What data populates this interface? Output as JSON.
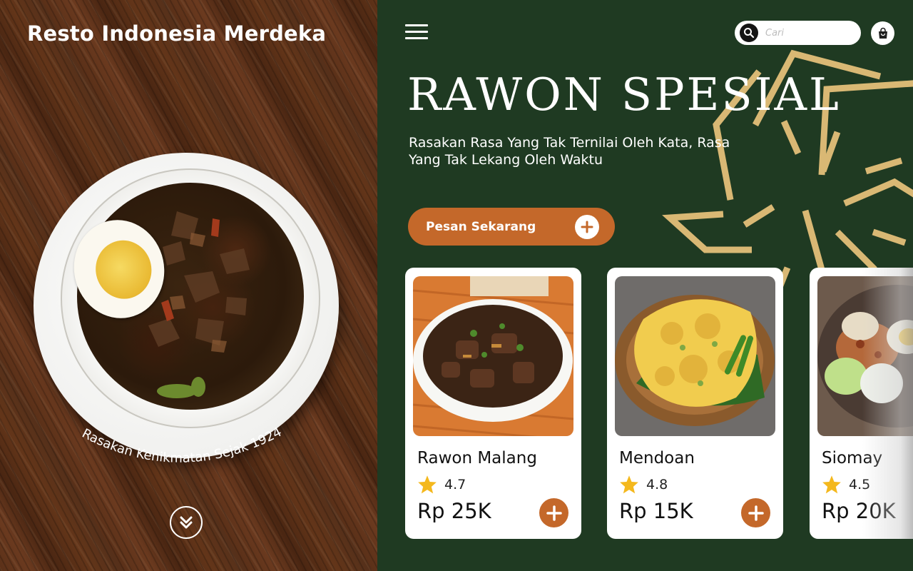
{
  "brand": {
    "name": "Resto Indonesia Merdeka"
  },
  "hero_left": {
    "tagline": "Rasakan Kenikmatan Sejak 1924"
  },
  "header": {
    "search": {
      "placeholder": "Cari",
      "value": ""
    },
    "search_icon": "search-icon",
    "cart_icon": "shopping-bag-icon",
    "menu_icon": "hamburger-menu-icon"
  },
  "hero": {
    "title": "RAWON SPESIAL",
    "subtitle": "Rasakan Rasa Yang Tak Ternilai Oleh Kata, Rasa Yang Tak Lekang Oleh Waktu",
    "cta_label": "Pesan Sekarang"
  },
  "menu_items": [
    {
      "name": "Rawon Malang",
      "rating": "4.7",
      "price": "Rp 25K"
    },
    {
      "name": "Mendoan",
      "rating": "4.8",
      "price": "Rp 15K"
    },
    {
      "name": "Siomay",
      "rating": "4.5",
      "price": "Rp 20K"
    }
  ],
  "colors": {
    "panel_green": "#1f3a22",
    "accent_orange": "#c4682a",
    "gold": "#d9b874",
    "star": "#f4b81d"
  }
}
